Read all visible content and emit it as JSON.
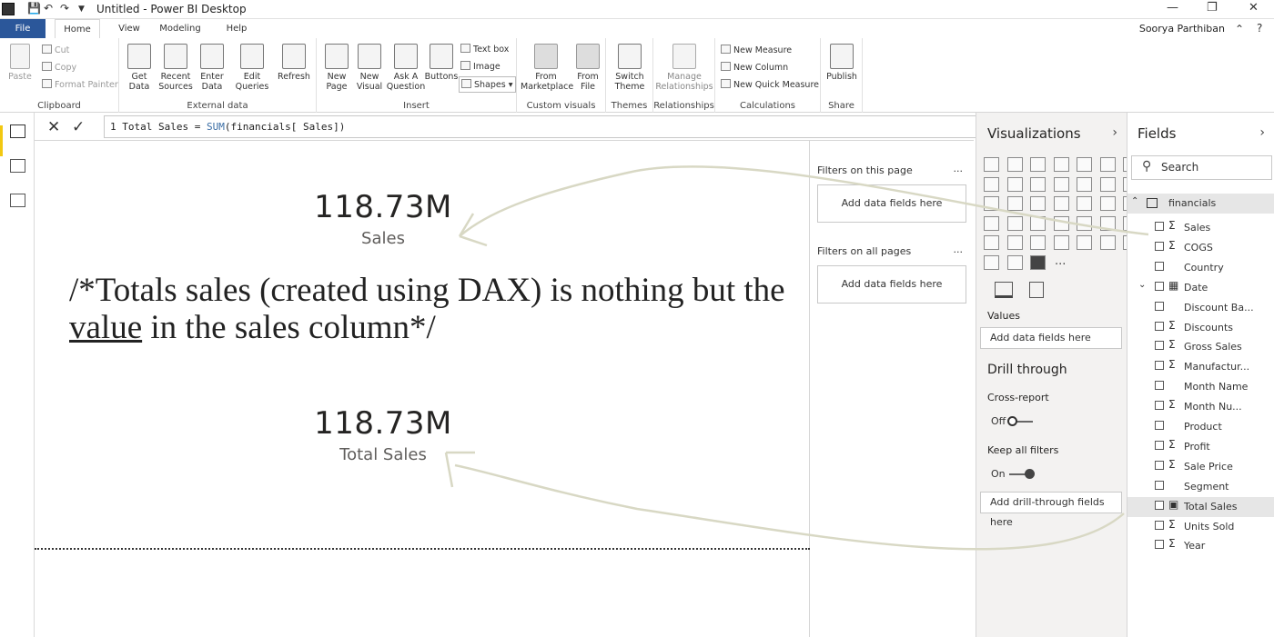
{
  "window": {
    "title": "Untitled - Power BI Desktop",
    "user": "Soorya Parthiban"
  },
  "ribbon_tabs": [
    "File",
    "Home",
    "View",
    "Modeling",
    "Help"
  ],
  "ribbon": {
    "clipboard": {
      "label": "Clipboard",
      "paste": "Paste",
      "cut": "Cut",
      "copy": "Copy",
      "format_painter": "Format Painter"
    },
    "external_data": {
      "label": "External data",
      "get_data": "Get Data",
      "recent_sources": "Recent Sources",
      "enter_data": "Enter Data",
      "edit_queries": "Edit Queries",
      "refresh": "Refresh"
    },
    "insert": {
      "label": "Insert",
      "new_page": "New Page",
      "new_visual": "New Visual",
      "ask_question": "Ask A Question",
      "buttons": "Buttons",
      "text_box": "Text box",
      "image": "Image",
      "shapes": "Shapes"
    },
    "custom_visuals": {
      "label": "Custom visuals",
      "from_marketplace": "From Marketplace",
      "from_file": "From File"
    },
    "themes": {
      "label": "Themes",
      "switch_theme": "Switch Theme"
    },
    "relationships": {
      "label": "Relationships",
      "manage": "Manage Relationships"
    },
    "calculations": {
      "label": "Calculations",
      "new_measure": "New Measure",
      "new_column": "New Column",
      "new_quick_measure": "New Quick Measure"
    },
    "share": {
      "label": "Share",
      "publish": "Publish"
    }
  },
  "formula_bar": {
    "line_number": "1",
    "measure_name": "Total Sales",
    "operator": "=",
    "function": "SUM",
    "argument": "(financials[ Sales])"
  },
  "canvas": {
    "card1": {
      "value": "118.73M",
      "label": "Sales"
    },
    "note": {
      "before": "/*Totals sales (created using DAX) is nothing but the ",
      "underlined": "value",
      "after": " in the sales column*/"
    },
    "card2": {
      "value": "118.73M",
      "label": "Total Sales"
    }
  },
  "filters": {
    "on_this_page": "Filters on this page",
    "on_all_pages": "Filters on all pages",
    "well_text": "Add data fields here",
    "more": "..."
  },
  "visualizations": {
    "title": "Visualizations",
    "values_label": "Values",
    "values_well": "Add data fields here",
    "drill_through": "Drill through",
    "cross_report": "Cross-report",
    "cross_report_state": "Off",
    "keep_all_filters": "Keep all filters",
    "keep_all_filters_state": "On",
    "drill_well": "Add drill-through fields here",
    "more": "..."
  },
  "fields": {
    "title": "Fields",
    "search_placeholder": "Search",
    "table": "financials",
    "items": [
      {
        "name": "Sales",
        "sigma": true,
        "selected": false
      },
      {
        "name": "COGS",
        "sigma": true,
        "selected": false
      },
      {
        "name": "Country",
        "sigma": false,
        "selected": false
      },
      {
        "name": "Date",
        "sigma": false,
        "selected": false,
        "is_date": true
      },
      {
        "name": "Discount Ba...",
        "sigma": false,
        "selected": false
      },
      {
        "name": "Discounts",
        "sigma": true,
        "selected": false
      },
      {
        "name": "Gross Sales",
        "sigma": true,
        "selected": false
      },
      {
        "name": "Manufactur...",
        "sigma": true,
        "selected": false
      },
      {
        "name": "Month Name",
        "sigma": false,
        "selected": false
      },
      {
        "name": "Month Nu...",
        "sigma": true,
        "selected": false
      },
      {
        "name": "Product",
        "sigma": false,
        "selected": false
      },
      {
        "name": "Profit",
        "sigma": true,
        "selected": false
      },
      {
        "name": "Sale Price",
        "sigma": true,
        "selected": false
      },
      {
        "name": "Segment",
        "sigma": false,
        "selected": false
      },
      {
        "name": "Total Sales",
        "sigma": false,
        "selected": true,
        "is_measure": true
      },
      {
        "name": "Units Sold",
        "sigma": true,
        "selected": false
      },
      {
        "name": "Year",
        "sigma": true,
        "selected": false
      }
    ]
  },
  "colors": {
    "file_tab": "#2b579a",
    "accent_yellow": "#f2c811",
    "annotation_line": "#d8d8c4"
  }
}
